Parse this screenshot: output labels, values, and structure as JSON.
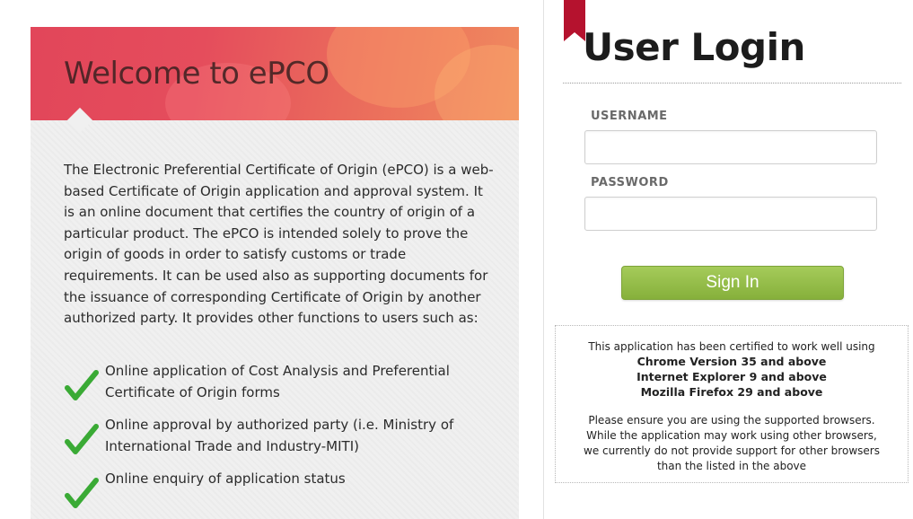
{
  "welcome": {
    "title": "Welcome to ePCO",
    "description": "The Electronic Preferential Certificate of Origin (ePCO) is a web-based Certificate of Origin application and approval system. It is an online document that certifies the country of origin of a particular product. The ePCO is intended solely to prove the origin of goods in order to satisfy customs or trade requirements. It can be used also as supporting documents for the issuance of corresponding Certificate of Origin by another authorized party. It provides other functions to users such as:",
    "features": [
      {
        "text": "Online application of Cost Analysis and Preferential Certificate of Origin forms",
        "icon": "check-icon"
      },
      {
        "text": "Online approval by authorized party (i.e. Ministry of International Trade and Industry-MITI)",
        "icon": "check-icon"
      },
      {
        "text": "Online enquiry of application status",
        "icon": "check-icon"
      }
    ]
  },
  "login": {
    "title": "User Login",
    "username_label": "USERNAME",
    "username_value": "",
    "password_label": "PASSWORD",
    "password_value": "",
    "sign_in_label": "Sign In"
  },
  "notice": {
    "intro": "This application has been certified to work well using",
    "browsers": [
      "Chrome Version 35 and above",
      "Internet Explorer 9 and above",
      "Mozilla Firefox 29 and above"
    ],
    "support_lines": [
      "Please ensure you are using the supported browsers.",
      "While the application may work using other browsers,",
      "we currently do not provide support for other browsers",
      "than the listed in the above"
    ]
  },
  "colors": {
    "banner": "#e2465a",
    "ribbon": "#b5122e",
    "check": "#3aaa35",
    "sign_in": "#93bd48"
  }
}
